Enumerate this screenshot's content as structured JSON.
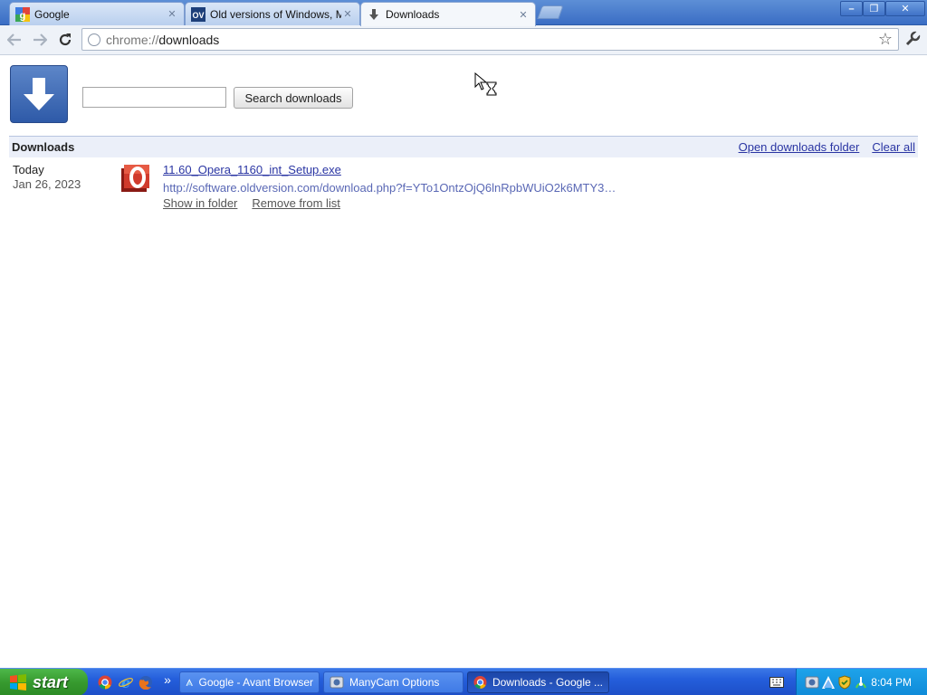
{
  "tabs": [
    {
      "label": "Google"
    },
    {
      "label": "Old versions of Windows, Mac"
    },
    {
      "label": "Downloads"
    }
  ],
  "window_controls": {
    "minimize": "–",
    "maximize": "❐",
    "close": "✕"
  },
  "toolbar": {
    "url_scheme": "chrome://",
    "url_path": "downloads"
  },
  "search": {
    "value": "",
    "button_label": "Search downloads"
  },
  "section": {
    "title": "Downloads",
    "open_folder_label": "Open downloads folder",
    "clear_all_label": "Clear all"
  },
  "download": {
    "date_label": "Today",
    "date": "Jan 26, 2023",
    "file_name": "11.60_Opera_1160_int_Setup.exe",
    "url": "http://software.oldversion.com/download.php?f=YTo1OntzOjQ6lnRpbWUiO2k6MTY3…",
    "show_in_folder_label": "Show in folder",
    "remove_label": "Remove from list"
  },
  "taskbar": {
    "start_label": "start",
    "overflow_label": "»",
    "tasks": [
      {
        "label": "Google - Avant Browser"
      },
      {
        "label": "ManyCam Options"
      },
      {
        "label": "Downloads - Google ..."
      }
    ],
    "clock": "8:04 PM"
  },
  "colors": {
    "link": "#2a35a3",
    "section_bg": "#ebeff9",
    "taskbar_blue": "#245edb",
    "start_green": "#379a2f"
  }
}
